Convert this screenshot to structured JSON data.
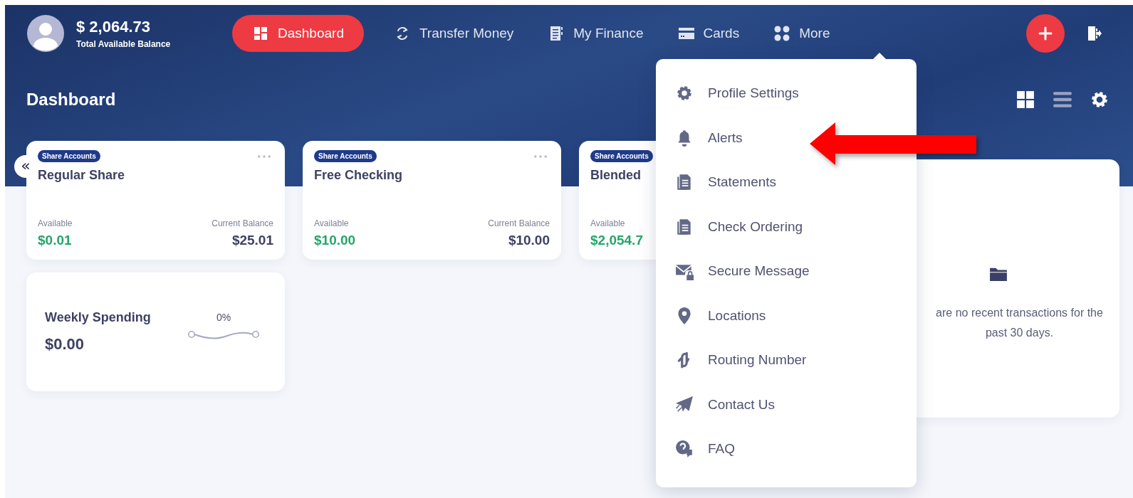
{
  "user": {
    "balance": "$ 2,064.73",
    "balance_label": "Total Available Balance"
  },
  "nav": [
    {
      "label": "Dashboard",
      "selected": true
    },
    {
      "label": "Transfer Money",
      "selected": false
    },
    {
      "label": "My Finance",
      "selected": false
    },
    {
      "label": "Cards",
      "selected": false
    },
    {
      "label": "More",
      "selected": false
    }
  ],
  "page_title": "Dashboard",
  "view_modes": [
    {
      "selected": true
    },
    {
      "selected": false
    }
  ],
  "collapse_button": "«",
  "accounts": [
    {
      "badge": "Share Accounts",
      "name": "Regular Share",
      "available_label": "Available",
      "available": "$0.01",
      "balance_label": "Current Balance",
      "balance": "$25.01"
    },
    {
      "badge": "Share Accounts",
      "name": "Free Checking",
      "available_label": "Available",
      "available": "$10.00",
      "balance_label": "Current Balance",
      "balance": "$10.00"
    },
    {
      "badge": "Share Accounts",
      "name": "Blended",
      "available_label": "Available",
      "available": "$2,054.7"
    }
  ],
  "weekly_spending": {
    "title": "Weekly Spending",
    "amount": "$0.00",
    "change": "0%"
  },
  "transactions": {
    "message": "are no recent transactions for the past 30 days."
  },
  "menu": [
    "Profile Settings",
    "Alerts",
    "Statements",
    "Check Ordering",
    "Secure Message",
    "Locations",
    "Routing Number",
    "Contact Us",
    "FAQ"
  ]
}
